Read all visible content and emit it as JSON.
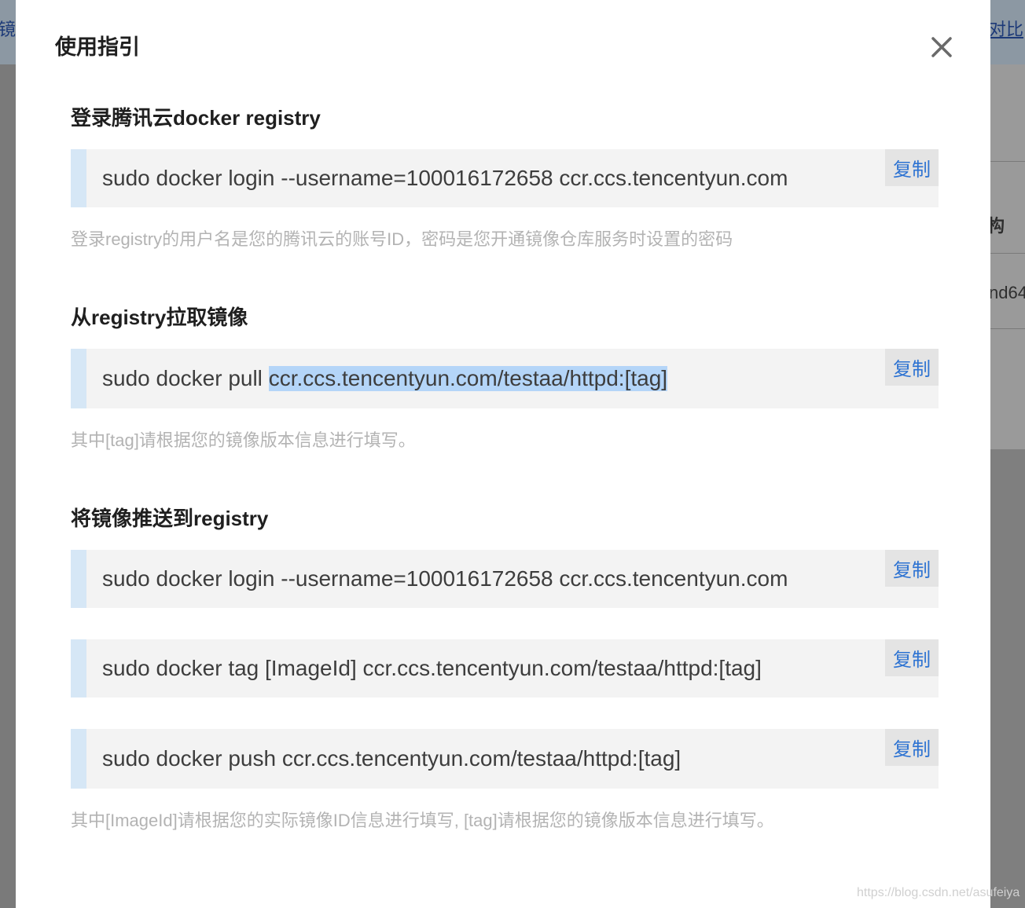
{
  "background": {
    "left_text": "镜",
    "right_link": "对比",
    "right_text_1": "构",
    "right_text_2": "nd64"
  },
  "modal": {
    "title": "使用指引",
    "close_icon": "close-icon"
  },
  "sections": [
    {
      "title": "登录腾讯云docker registry",
      "commands": [
        {
          "text": "sudo docker login --username=100016172658 ccr.ccs.tencentyun.com",
          "copy_label": "复制"
        }
      ],
      "hint": "登录registry的用户名是您的腾讯云的账号ID，密码是您开通镜像仓库服务时设置的密码"
    },
    {
      "title": "从registry拉取镜像",
      "commands": [
        {
          "text_prefix": "sudo docker pull ",
          "text_selected": "ccr.ccs.tencentyun.com/testaa/httpd:[tag]",
          "copy_label": "复制"
        }
      ],
      "hint": "其中[tag]请根据您的镜像版本信息进行填写。"
    },
    {
      "title": "将镜像推送到registry",
      "commands": [
        {
          "text": "sudo docker login --username=100016172658 ccr.ccs.tencentyun.com",
          "copy_label": "复制"
        },
        {
          "text": "sudo docker tag [ImageId] ccr.ccs.tencentyun.com/testaa/httpd:[tag]",
          "copy_label": "复制"
        },
        {
          "text": "sudo docker push ccr.ccs.tencentyun.com/testaa/httpd:[tag]",
          "copy_label": "复制"
        }
      ],
      "hint": "其中[ImageId]请根据您的实际镜像ID信息进行填写, [tag]请根据您的镜像版本信息进行填写。"
    }
  ],
  "watermark": "https://blog.csdn.net/asufeiya"
}
